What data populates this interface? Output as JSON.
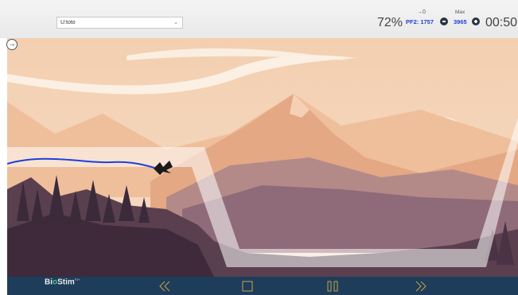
{
  "header": {
    "user_select": {
      "value": "U:toto",
      "chevron": "⌄"
    },
    "percent": "72%",
    "arrow_zero_label": "→0",
    "pf2_label": "PF2: 1757",
    "max_label": "Max",
    "max_value": "3965",
    "timer": "00:50"
  },
  "side_button_icon": "→",
  "bottombar": {
    "logo_text_prefix": "Bi",
    "logo_text_o": "o",
    "logo_text_suffix": "Stim",
    "logo_superscript": "F2+",
    "controls": [
      "rewind-icon",
      "stop-icon",
      "pause-icon",
      "fast-forward-icon"
    ]
  },
  "colors": {
    "accent": "#1f3fd6",
    "bottombar": "#1d3d5a",
    "trace": "#1f3fd6",
    "control_icon": "#c9a44b"
  }
}
